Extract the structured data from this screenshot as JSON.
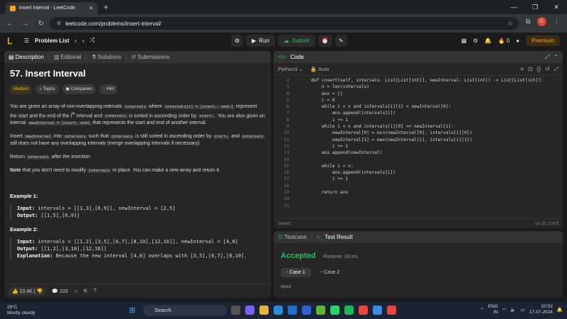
{
  "browser": {
    "tab_title": "Insert Interval - LeetCode",
    "url": "leetcode.com/problems/insert-interval/",
    "profile_initial": "C"
  },
  "nav": {
    "problem_list": "Problem List",
    "run": "Run",
    "submit": "Submit",
    "fire_count": "0",
    "premium": "Premium"
  },
  "left_tabs": [
    "Description",
    "Editorial",
    "Solutions",
    "Submissions"
  ],
  "problem": {
    "title": "57. Insert Interval",
    "difficulty": "Medium",
    "badges": [
      "Topics",
      "Companies",
      "Hint"
    ],
    "p1_a": "You are given an array of non-overlapping intervals",
    "code_intervals": "intervals",
    "p1_b": "where",
    "code_intervals_i": "intervals[i] = [start",
    "p1_c": "represent the start and the end of the i",
    "p1_d": "interval and",
    "p1_e": "is sorted in ascending order by",
    "code_start_i": "start",
    "p1_f": "You are also given an interval",
    "code_newInterval": "newInterval = [start, end]",
    "p1_g": "that represents the start and end of another interval.",
    "p2_a": "Insert",
    "code_newInterval_short": "newInterval",
    "p2_b": "into",
    "p2_c": "such that",
    "p2_d": "is still sorted in ascending order by",
    "p2_e": "and",
    "p2_f": "still does not have any overlapping intervals (merge overlapping intervals if necessary).",
    "p3_a": "Return",
    "p3_b": "after the insertion.",
    "p4_a": "Note",
    "p4_b": "that you don't need to modify",
    "p4_c": "in-place. You can make a new array and return it.",
    "ex1_title": "Example 1:",
    "ex1_input": "intervals = [[1,3],[6,9]], newInterval = [2,5]",
    "ex1_output": "[[1,5],[6,9]]",
    "ex2_title": "Example 2:",
    "ex2_input": "intervals = [[1,2],[3,5],[6,7],[8,10],[12,16]], newInterval = [4,8]",
    "ex2_output": "[[1,2],[3,10],[12,16]]",
    "ex2_expl": "Because the new interval [4,8] overlaps with [3,5],[6,7],[8,10].",
    "label_input": "Input:",
    "label_output": "Output:",
    "label_expl": "Explanation:",
    "likes": "10.4K",
    "comments": "233"
  },
  "code_panel": {
    "title": "Code",
    "language": "Python3",
    "mode": "Auto",
    "status": "Saved",
    "cursor": "Ln 21, Col 9"
  },
  "code_lines": [
    {
      "n": "2",
      "t": "    def insert(self, intervals: List[List[int]], newInterval: List[int]) -> List[List[int]]:"
    },
    {
      "n": "3",
      "t": "        n = len(intervals)"
    },
    {
      "n": "4",
      "t": "        ans = []"
    },
    {
      "n": "5",
      "t": "        i = 0"
    },
    {
      "n": "6",
      "t": "        while i < n and intervals[i][1] < newInterval[0]:"
    },
    {
      "n": "7",
      "t": "            ans.append(intervals[i])"
    },
    {
      "n": "8",
      "t": "            i += 1"
    },
    {
      "n": "9",
      "t": "        while i < n and intervals[i][0] <= newInterval[1]:"
    },
    {
      "n": "10",
      "t": "            newInterval[0] = min(newInterval[0], intervals[i][0])"
    },
    {
      "n": "11",
      "t": "            newInterval[1] = max(newInterval[1], intervals[i][1])"
    },
    {
      "n": "12",
      "t": "            i += 1"
    },
    {
      "n": "13",
      "t": "        ans.append(newInterval)"
    },
    {
      "n": "14",
      "t": ""
    },
    {
      "n": "15",
      "t": "        while i < n:"
    },
    {
      "n": "16",
      "t": "            ans.append(intervals[i])"
    },
    {
      "n": "17",
      "t": "            i += 1"
    },
    {
      "n": "18",
      "t": ""
    },
    {
      "n": "19",
      "t": "        return ans"
    },
    {
      "n": "20",
      "t": ""
    },
    {
      "n": "21",
      "t": "        "
    }
  ],
  "bottom": {
    "tab_testcase": "Testcase",
    "tab_result": "Test Result",
    "verdict": "Accepted",
    "runtime": "Runtime: 33 ms",
    "case1": "Case 1",
    "case2": "Case 2",
    "input_label": "Input"
  },
  "taskbar": {
    "temp": "29°C",
    "weather": "Mostly cloudy",
    "search": "Search",
    "lang1": "ENG",
    "lang2": "IN",
    "time": "20:52",
    "date": "17-07-2024"
  }
}
